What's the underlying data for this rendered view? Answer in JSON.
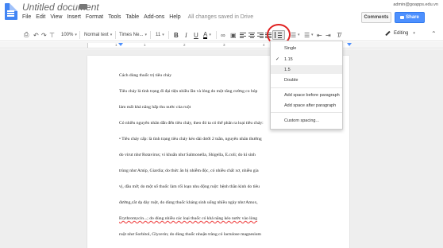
{
  "app": {
    "title": "Untitled document",
    "menu": [
      "File",
      "Edit",
      "View",
      "Insert",
      "Format",
      "Tools",
      "Table",
      "Add-ons",
      "Help"
    ],
    "save_status": "All changes saved in Drive",
    "user_email": "admin@goapps.edu.vn",
    "comments_label": "Comments",
    "share_label": "Share"
  },
  "toolbar": {
    "zoom": "100%",
    "style": "Normal text",
    "font": "Times Ne...",
    "font_size": "11",
    "bold": "B",
    "italic": "I",
    "underline": "U",
    "text_color": "A",
    "mode": "Editing"
  },
  "ruler": {
    "numbers": [
      "1",
      "1",
      "2",
      "3",
      "4"
    ]
  },
  "document": {
    "lines": [
      "Cách dùng thuốc trị tiêu chảy",
      "Tiêu chảy là tình trạng đi đại tiện nhiều lần và lỏng do một tăng cường co bóp",
      "làm mất khả năng hấp thu nước của ruột",
      "Có nhiều nguyên nhân dẫn đến tiêu chảy, theo đó ta có thể phân ra loại tiêu chảy:",
      "• Tiêu chảy cấp: là tình trạng tiêu chảy kéo dài dưới 2 tuần, nguyên nhân thường",
      "do virut như Rotavirus; vi khuẩn như Salmonella, Shigella, E.coli; do kí sinh",
      "trùng như Amip, Giardia; do thức ăn bị nhiễm độc, có nhiều chất xơ, nhiều gia",
      "vị, dầu mỡ; do một số thuốc làm rối loạn nhu động ruột: bệnh thần kinh do tiêu",
      "đường,cắt dạ dày ruột, do dùng thuốc kháng sinh uống nhiều ngày như Amox,",
      "Erythromycin...; do dùng nhiều các loại thuốc có khả năng kéo nước vào lòng",
      "ruột như Sorbitol, Glycerin; do dùng thuốc nhuận tràng có lactulose magnesium"
    ]
  },
  "line_spacing_menu": {
    "options": [
      "Single",
      "1.15",
      "1.5",
      "Double"
    ],
    "selected": "1.15",
    "highlighted": "1.5",
    "add_before": "Add space before paragraph",
    "add_after": "Add space after paragraph",
    "custom": "Custom spacing...",
    "checkmark": "✓"
  },
  "colors": {
    "brand_blue": "#4285f4",
    "share_blue": "#4d90fe",
    "annotation_red": "#e02020"
  }
}
